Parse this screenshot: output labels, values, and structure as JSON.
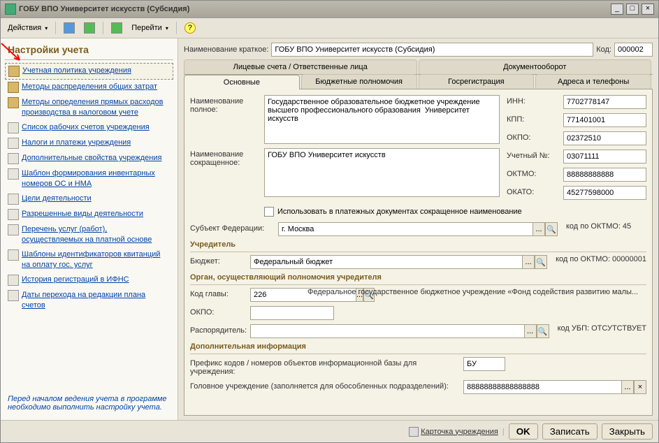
{
  "window": {
    "title": "ГОБУ ВПО Университет искусств (Субсидия)"
  },
  "toolbar": {
    "actions": "Действия",
    "goto": "Перейти"
  },
  "sidebar": {
    "heading": "Настройки учета",
    "items": [
      "Учетная политика учреждения",
      "Методы распределения общих затрат",
      "Методы определения прямых расходов производства в налоговом учете",
      "Список рабочих счетов учреждения",
      "Налоги и платежи учреждения",
      "Дополнительные свойства учреждения",
      "Шаблон формирования инвентарных номеров ОС и НМА",
      "Цели деятельности",
      "Разрешенные виды деятельности",
      "Перечень услуг (работ), осуществляемых на платной основе",
      "Шаблоны идентификаторов квитанций на оплату гос. услуг",
      "История регистраций в ИФНС",
      "Даты перехода на редакции плана счетов"
    ],
    "note": "Перед началом ведения учета в программе необходимо выполнить настройку учета."
  },
  "main": {
    "short_name_label": "Наименование краткое:",
    "short_name": "ГОБУ ВПО Университет искусств (Субсидия)",
    "code_label": "Код:",
    "code": "000002",
    "tabs1": [
      "Лицевые счета / Ответственные лица",
      "Документооборот"
    ],
    "tabs2": [
      "Основные",
      "Бюджетные полномочия",
      "Госрегистрация",
      "Адреса и телефоны"
    ],
    "full_name_label": "Наименование полное:",
    "full_name": "Государственное образовательное бюджетное учреждение высшего профессионального образования  Университет искусств",
    "short2_label": "Наименование сокращенное:",
    "short2": "ГОБУ ВПО Университет искусств",
    "checkbox_label": "Использовать в платежных документах сокращенное наименование",
    "ids": {
      "inn_label": "ИНН:",
      "inn": "7702778147",
      "kpp_label": "КПП:",
      "kpp": "771401001",
      "okpo_label": "ОКПО:",
      "okpo": "02372510",
      "uch_label": "Учетный №:",
      "uch": "03071111",
      "oktmo_label": "ОКТМО:",
      "oktmo": "88888888888",
      "okato_label": "ОКАТО:",
      "okato": "45277598000"
    },
    "subject_label": "Субъект Федерации:",
    "subject": "г. Москва",
    "subject_suffix": "код по ОКТМО: 45",
    "founder_title": "Учредитель",
    "budget_label": "Бюджет:",
    "budget": "Федеральный бюджет",
    "budget_suffix": "код по ОКТМО: 00000001",
    "organ_title": "Орган, осуществляющий полномочия учредителя",
    "chapter_label": "Код главы:",
    "chapter": "226",
    "chapter_text": "Федеральное государственное бюджетное учреждение «Фонд содействия развитию малы...",
    "okpo2_label": "ОКПО:",
    "okpo2": "",
    "rasp_label": "Распорядитель:",
    "rasp": "",
    "rasp_suffix": "код УБП: ОТСУТСТВУЕТ",
    "addl_title": "Дополнительная информация",
    "prefix_label": "Префикс кодов / номеров объектов информационной базы для учреждения:",
    "prefix": "БУ",
    "head_label": "Головное учреждение (заполняется для обособленных подразделений):",
    "head": "88888888888888888"
  },
  "footer": {
    "card": "Карточка учреждения",
    "ok": "OK",
    "save": "Записать",
    "close": "Закрыть"
  }
}
